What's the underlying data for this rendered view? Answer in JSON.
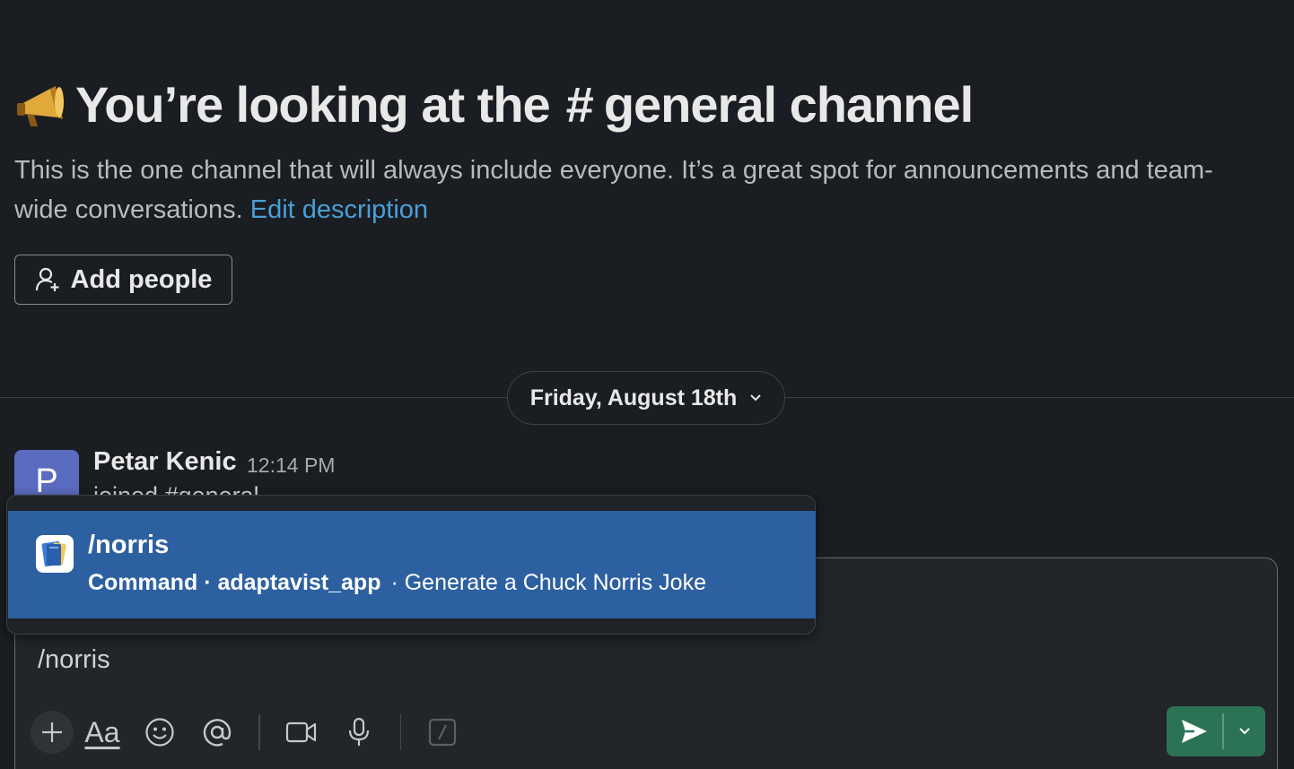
{
  "intro": {
    "title_prefix": "You’re looking at the",
    "hash": "#",
    "channel_name": "general channel",
    "description": "This is the one channel that will always include everyone. It’s a great spot for announcements and team-wide conversations.",
    "edit_link": "Edit description",
    "add_people_label": "Add people"
  },
  "date_divider": {
    "label": "Friday, August 18th"
  },
  "message": {
    "avatar_letter": "P",
    "author": "Petar Kenic",
    "time": "12:14 PM",
    "text": "joined #general."
  },
  "autocomplete": {
    "command": "/norris",
    "type_label": "Command",
    "separator": "·",
    "app_name": "adaptavist_app",
    "description": "Generate a Chuck Norris Joke"
  },
  "composer": {
    "input_text": "/norris",
    "format_label": "Aa"
  },
  "colors": {
    "background": "#1a1d21",
    "link": "#4a9fd8",
    "highlight": "#2d60a0",
    "send_button": "#2c7355",
    "avatar": "#5b6bc0"
  },
  "icons": [
    "megaphone-icon",
    "add-person-icon",
    "chevron-down-icon",
    "plus-icon",
    "emoji-icon",
    "mention-icon",
    "video-icon",
    "microphone-icon",
    "slash-shortcut-icon",
    "send-icon",
    "app-book-icon"
  ]
}
